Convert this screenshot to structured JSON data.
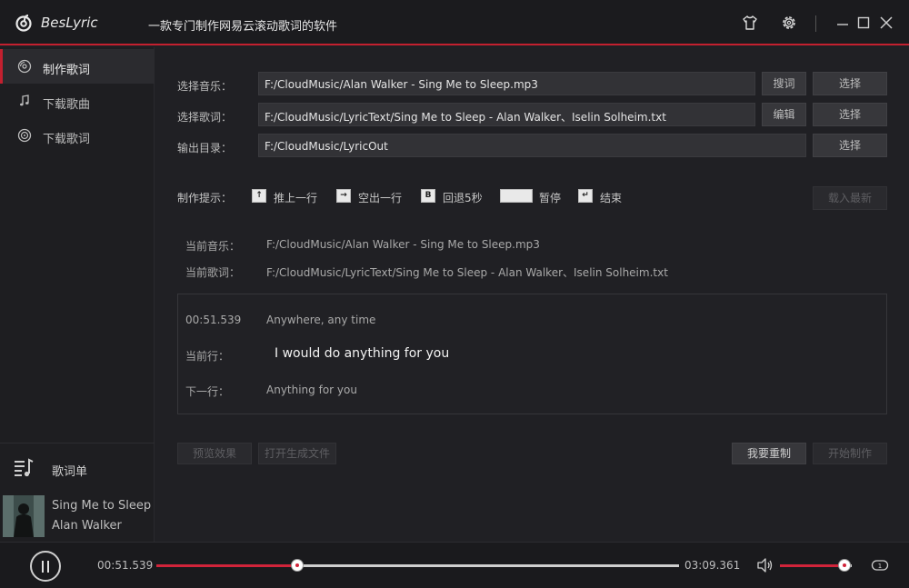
{
  "app": {
    "name": "BesLyric",
    "tagline": "一款专门制作网易云滚动歌词的软件"
  },
  "sidebar": {
    "items": [
      {
        "label": "制作歌词",
        "icon": "disc-icon",
        "active": true
      },
      {
        "label": "下载歌曲",
        "icon": "music-note-icon",
        "active": false
      },
      {
        "label": "下载歌词",
        "icon": "radio-icon",
        "active": false
      }
    ],
    "playlist_label": "歌词单",
    "now_playing": {
      "title": "Sing Me to Sleep",
      "artist": "Alan Walker"
    }
  },
  "form": {
    "music_label": "选择音乐：",
    "music_path": "F:/CloudMusic/Alan Walker - Sing Me to Sleep.mp3",
    "search_lyric_btn": "搜词",
    "lyric_label": "选择歌词：",
    "lyric_path": "F:/CloudMusic/LyricText/Sing Me to Sleep - Alan Walker、Iselin Solheim.txt",
    "edit_btn": "编辑",
    "output_label": "输出目录：",
    "output_path": "F:/CloudMusic/LyricOut",
    "choose_btn": "选择"
  },
  "hints": {
    "label": "制作提示：",
    "items": [
      {
        "key": "↑",
        "text": "推上一行"
      },
      {
        "key": "→",
        "text": "空出一行"
      },
      {
        "key": "B",
        "text": "回退5秒"
      },
      {
        "key": "",
        "text": "暂停"
      },
      {
        "key": "↵",
        "text": "结束"
      }
    ],
    "load_latest_btn": "载入最新"
  },
  "current": {
    "music_label": "当前音乐：",
    "music_value": "F:/CloudMusic/Alan Walker - Sing Me to Sleep.mp3",
    "lyric_label": "当前歌词：",
    "lyric_value": "F:/CloudMusic/LyricText/Sing Me to Sleep - Alan Walker、Iselin Solheim.txt"
  },
  "lyrics": {
    "prev_time": "00:51.539",
    "prev_line": "Anywhere, any time",
    "current_label": "当前行：",
    "current_line": "I would do anything for you",
    "next_label": "下一行：",
    "next_line": "Anything for you"
  },
  "actions": {
    "preview": "预览效果",
    "open_file": "打开生成文件",
    "reset": "我要重制",
    "start": "开始制作"
  },
  "player": {
    "elapsed": "00:51.539",
    "total": "03:09.361",
    "progress": 0.27,
    "volume": 0.9
  },
  "colors": {
    "accent": "#c3202f",
    "background": "#202024"
  }
}
